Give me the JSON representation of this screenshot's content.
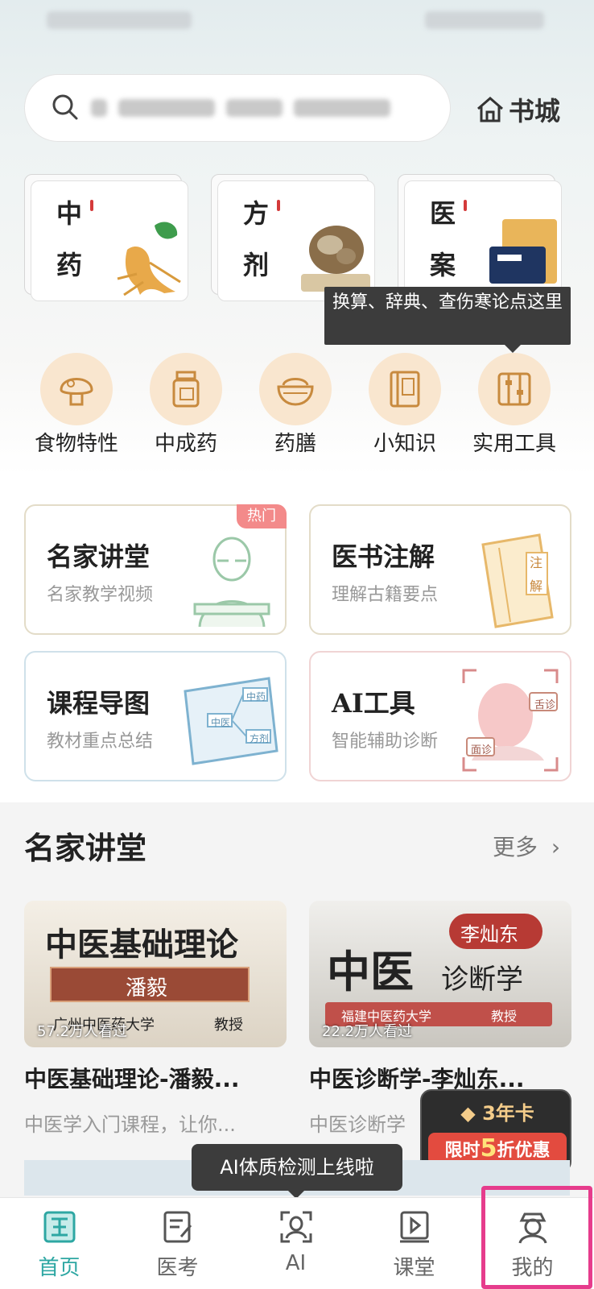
{
  "search": {
    "placeholder": "",
    "store_label": "书城"
  },
  "categories": [
    {
      "chars": [
        "中",
        "药"
      ]
    },
    {
      "chars": [
        "方",
        "剂"
      ]
    },
    {
      "chars": [
        "医",
        "案"
      ]
    }
  ],
  "tooltip_tools": "换算、辞典、查伤寒论点这里",
  "quick_icons": [
    {
      "label": "食物特性",
      "icon": "mushroom-icon"
    },
    {
      "label": "中成药",
      "icon": "medicine-bottle-icon"
    },
    {
      "label": "药膳",
      "icon": "food-bowl-icon"
    },
    {
      "label": "小知识",
      "icon": "book-icon"
    },
    {
      "label": "实用工具",
      "icon": "abacus-icon"
    }
  ],
  "feature_cards": [
    {
      "title": "名家讲堂",
      "subtitle": "名家教学视频",
      "badge": "热门"
    },
    {
      "title": "医书注解",
      "subtitle": "理解古籍要点",
      "art": [
        "注",
        "解"
      ]
    },
    {
      "title": "课程导图",
      "subtitle": "教材重点总结",
      "art": [
        "中医",
        "中药",
        "方剂"
      ]
    },
    {
      "title": "AI工具",
      "subtitle": "智能辅助诊断",
      "art": [
        "舌诊",
        "面诊"
      ]
    }
  ],
  "section": {
    "title": "名家讲堂",
    "more": "更多"
  },
  "videos": [
    {
      "thumb_title": "中医基础理论",
      "thumb_name": "潘毅",
      "thumb_org": "广州中医药大学",
      "thumb_role": "教授",
      "views": "57.2万人看过",
      "title": "中医基础理论-潘毅...",
      "subtitle": "中医学入门课程，让你..."
    },
    {
      "thumb_title": "中医",
      "thumb_sub": "诊断学",
      "thumb_name": "李灿东",
      "thumb_org": "福建中医药大学",
      "thumb_role": "教授",
      "views": "22.2万人看过",
      "title": "中医诊断学-李灿东...",
      "subtitle": "中医诊断学"
    }
  ],
  "promo": {
    "card": "3年卡",
    "prefix": "限时",
    "num": "5",
    "suffix": "折优惠"
  },
  "tooltip_ai": "AI体质检测上线啦",
  "tabs": [
    {
      "label": "首页",
      "icon": "home-icon",
      "active": true
    },
    {
      "label": "医考",
      "icon": "exam-icon"
    },
    {
      "label": "AI",
      "icon": "ai-scan-icon"
    },
    {
      "label": "课堂",
      "icon": "classroom-icon"
    },
    {
      "label": "我的",
      "icon": "profile-icon"
    }
  ],
  "colors": {
    "accent": "#2ea7a3",
    "highlight": "#e63c8c",
    "promo_red": "#e34b3f",
    "icon_bg": "#f9e6cf"
  }
}
